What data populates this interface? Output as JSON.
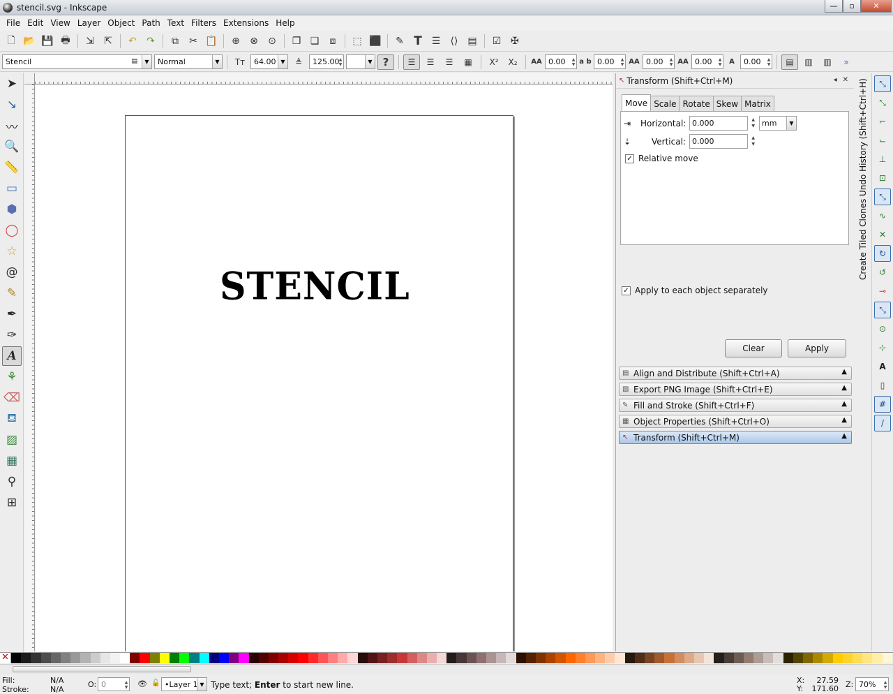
{
  "window": {
    "title": "stencil.svg - Inkscape",
    "minimize": "—",
    "maximize": "▫",
    "close": "✕"
  },
  "menu": [
    "File",
    "Edit",
    "View",
    "Layer",
    "Object",
    "Path",
    "Text",
    "Filters",
    "Extensions",
    "Help"
  ],
  "text_toolbar": {
    "font_family": "Stencil",
    "font_style": "Normal",
    "font_size": "64.00",
    "line_spacing": "125.00",
    "help": "?",
    "letter_spacing": "0.00",
    "word_spacing": "0.00",
    "horizontal_kern": "0.00",
    "vertical_shift": "0.00",
    "rotation": "0.00"
  },
  "canvas": {
    "text": "STENCIL"
  },
  "dock": {
    "title": "Transform (Shift+Ctrl+M)",
    "tabs": [
      "Move",
      "Scale",
      "Rotate",
      "Skew",
      "Matrix"
    ],
    "horizontal_label": "Horizontal:",
    "horizontal_value": "0.000",
    "vertical_label": "Vertical:",
    "vertical_value": "0.000",
    "unit": "mm",
    "relative_move": "Relative move",
    "apply_each": "Apply to each object separately",
    "clear": "Clear",
    "apply": "Apply",
    "panels": [
      "Align and Distribute (Shift+Ctrl+A)",
      "Export PNG Image (Shift+Ctrl+E)",
      "Fill and Stroke (Shift+Ctrl+F)",
      "Object Properties (Shift+Ctrl+O)",
      "Transform (Shift+Ctrl+M)"
    ]
  },
  "vertical_tabs": {
    "undo_history": "Undo History (Shift+Ctrl+H)",
    "tiled_clones": "Create Tiled Clones"
  },
  "palette": [
    "#000000",
    "#1a1a1a",
    "#333333",
    "#4d4d4d",
    "#666666",
    "#808080",
    "#999999",
    "#b3b3b3",
    "#cccccc",
    "#e6e6e6",
    "#f2f2f2",
    "#ffffff",
    "#800000",
    "#ff0000",
    "#808000",
    "#ffff00",
    "#008000",
    "#00ff00",
    "#008080",
    "#00ffff",
    "#000080",
    "#0000ff",
    "#800080",
    "#ff00ff",
    "#2b0000",
    "#550000",
    "#800000",
    "#aa0000",
    "#d40000",
    "#ff0000",
    "#ff2a2a",
    "#ff5555",
    "#ff8080",
    "#ffaaaa",
    "#ffd5d5",
    "#280b0b",
    "#501616",
    "#782121",
    "#a02c2c",
    "#c83737",
    "#d35f5f",
    "#de8787",
    "#e9afaf",
    "#f4d7d7",
    "#241c1c",
    "#483737",
    "#6c5353",
    "#916f6f",
    "#ac9393",
    "#c8b7b7",
    "#e3dbdb",
    "#2b1100",
    "#552200",
    "#803300",
    "#aa4400",
    "#d45500",
    "#ff6600",
    "#ff7f2a",
    "#ff9955",
    "#ffb380",
    "#ffccaa",
    "#ffe6d5",
    "#28170b",
    "#502d16",
    "#784421",
    "#a05a2c",
    "#c87137",
    "#d38d5f",
    "#deaa87",
    "#e9c6af",
    "#f4e3d7",
    "#241f1c",
    "#483e37",
    "#6c5d53",
    "#917c6f",
    "#ac9d93",
    "#c8beb7",
    "#e3dedb",
    "#2b2200",
    "#554400",
    "#806600",
    "#aa8800",
    "#d4aa00",
    "#ffcc00",
    "#ffd42a",
    "#ffdd55",
    "#ffe680",
    "#ffeeaa",
    "#fff6d5"
  ],
  "status": {
    "fill_label": "Fill:",
    "fill_value": "N/A",
    "stroke_label": "Stroke:",
    "stroke_value": "N/A",
    "opacity_label": "O:",
    "opacity_value": "0",
    "layer": "•Layer 1",
    "message_pre": "Type text; ",
    "message_bold": "Enter",
    "message_post": " to start new line.",
    "x_label": "X:",
    "x_value": "27.59",
    "y_label": "Y:",
    "y_value": "171.60",
    "zoom_label": "Z:",
    "zoom_value": "70%"
  }
}
